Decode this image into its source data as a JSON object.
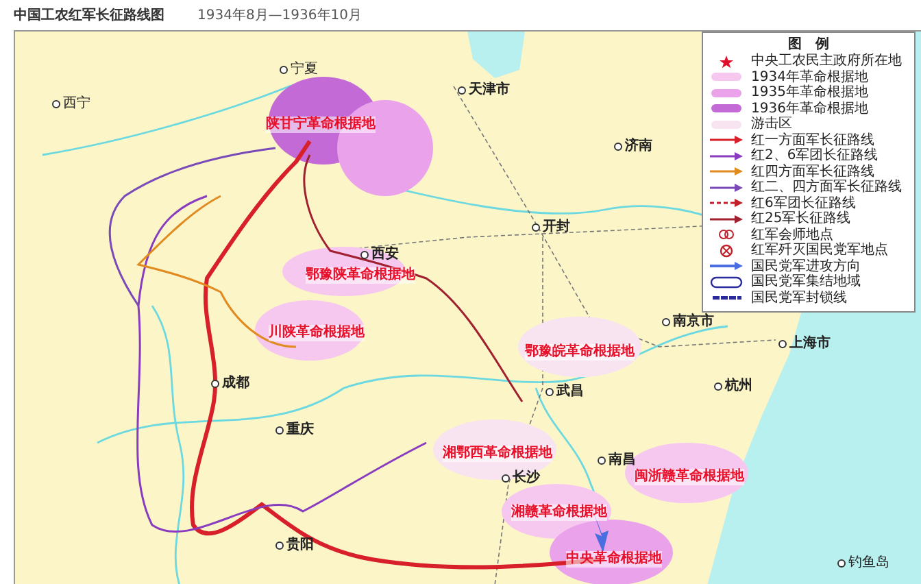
{
  "title": "中国工农红军长征路线图",
  "date_range": "1934年8月—1936年10月",
  "places": [
    {
      "name": "宁夏",
      "kind": "city"
    },
    {
      "name": "西宁",
      "kind": "city"
    },
    {
      "name": "天津市",
      "kind": "major"
    },
    {
      "name": "济南",
      "kind": "major"
    },
    {
      "name": "开封",
      "kind": "major"
    },
    {
      "name": "西安",
      "kind": "major"
    },
    {
      "name": "成都",
      "kind": "major"
    },
    {
      "name": "重庆",
      "kind": "major"
    },
    {
      "name": "贵阳",
      "kind": "major"
    },
    {
      "name": "南京市",
      "kind": "major"
    },
    {
      "name": "上海市",
      "kind": "major"
    },
    {
      "name": "杭州",
      "kind": "major"
    },
    {
      "name": "武昌",
      "kind": "major"
    },
    {
      "name": "南昌",
      "kind": "major"
    },
    {
      "name": "长沙",
      "kind": "major"
    },
    {
      "name": "钓鱼岛",
      "kind": "city"
    },
    {
      "name": "陕甘宁革命根据地",
      "kind": "base"
    },
    {
      "name": "鄂豫陕革命根据地",
      "kind": "base"
    },
    {
      "name": "川陕革命根据地",
      "kind": "base"
    },
    {
      "name": "鄂豫皖革命根据地",
      "kind": "base"
    },
    {
      "name": "湘鄂西革命根据地",
      "kind": "base"
    },
    {
      "name": "闽浙赣革命根据地",
      "kind": "base"
    },
    {
      "name": "湘赣革命根据地",
      "kind": "base"
    },
    {
      "name": "中央革命根据地",
      "kind": "base"
    }
  ],
  "legend": {
    "title": "图　例",
    "items": [
      {
        "label": "中央工农民主政府所在地",
        "kind": "star",
        "color": "#e0102a"
      },
      {
        "label": "1934年革命根据地",
        "kind": "area",
        "color": "#f6c8f0"
      },
      {
        "label": "1935年革命根据地",
        "kind": "area",
        "color": "#eaa2ea"
      },
      {
        "label": "1936年革命根据地",
        "kind": "area",
        "color": "#c46ad6"
      },
      {
        "label": "游击区",
        "kind": "area",
        "color": "#f8e4f0"
      },
      {
        "label": "红一方面军长征路线",
        "kind": "route",
        "color": "#d8202a"
      },
      {
        "label": "红2、6军团长征路线",
        "kind": "route",
        "color": "#8a3cc0"
      },
      {
        "label": "红四方面军长征路线",
        "kind": "route",
        "color": "#e08a20"
      },
      {
        "label": "红二、四方面军长征路线",
        "kind": "route",
        "color": "#7a4ab8"
      },
      {
        "label": "红6军团长征路线",
        "kind": "dashed",
        "color": "#c0202a"
      },
      {
        "label": "红25军长征路线",
        "kind": "route",
        "color": "#a02030"
      },
      {
        "label": "红军会师地点",
        "kind": "meet",
        "color": "#c0202a"
      },
      {
        "label": "红军歼灭国民党军地点",
        "kind": "battle",
        "color": "#c0202a"
      },
      {
        "label": "国民党军进攻方向",
        "kind": "attack",
        "color": "#4a6ee0"
      },
      {
        "label": "国民党军集结地域",
        "kind": "muster",
        "color": "#2a2a9a"
      },
      {
        "label": "国民党军封锁线",
        "kind": "blockade",
        "color": "#2a2a9a"
      }
    ]
  }
}
